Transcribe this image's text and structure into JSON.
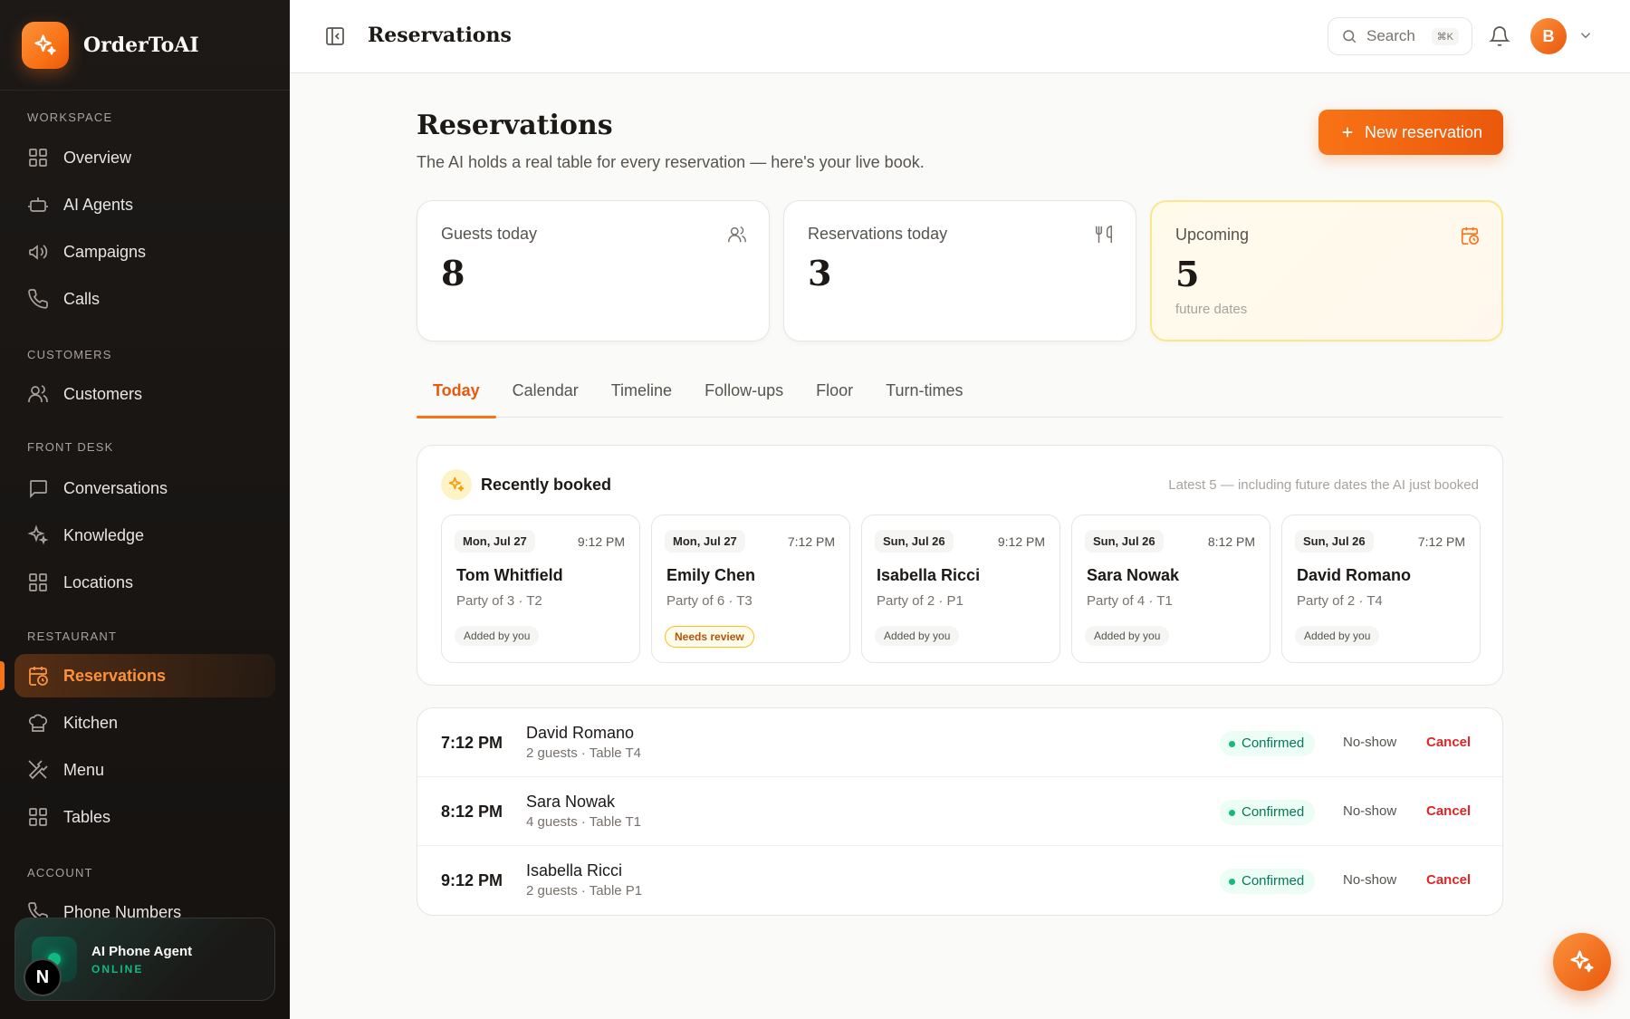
{
  "brand": {
    "name": "OrderToAI",
    "icon": "sparkle-icon",
    "accent": "#f97316"
  },
  "sidebar": {
    "sections": [
      {
        "label": "WORKSPACE",
        "items": [
          {
            "label": "Overview",
            "icon": "grid-icon"
          },
          {
            "label": "AI Agents",
            "icon": "robot-icon"
          },
          {
            "label": "Campaigns",
            "icon": "megaphone-icon"
          },
          {
            "label": "Calls",
            "icon": "phone-icon"
          }
        ]
      },
      {
        "label": "CUSTOMERS",
        "items": [
          {
            "label": "Customers",
            "icon": "users-icon"
          }
        ]
      },
      {
        "label": "FRONT DESK",
        "items": [
          {
            "label": "Conversations",
            "icon": "chat-icon"
          },
          {
            "label": "Knowledge",
            "icon": "sparkle-icon"
          },
          {
            "label": "Locations",
            "icon": "grid-icon"
          }
        ]
      },
      {
        "label": "RESTAURANT",
        "items": [
          {
            "label": "Reservations",
            "icon": "calendar-clock-icon",
            "active": true
          },
          {
            "label": "Kitchen",
            "icon": "chef-hat-icon"
          },
          {
            "label": "Menu",
            "icon": "utensils-crossed-icon"
          },
          {
            "label": "Tables",
            "icon": "grid-icon"
          }
        ]
      },
      {
        "label": "ACCOUNT",
        "items": [
          {
            "label": "Phone Numbers",
            "icon": "phone-icon"
          }
        ]
      }
    ],
    "agent": {
      "title": "AI Phone Agent",
      "status": "ONLINE",
      "status_color": "#10b981"
    },
    "n_badge": "N"
  },
  "topbar": {
    "title": "Reservations",
    "search_placeholder": "Search",
    "search_shortcut": "⌘K",
    "avatar_initial": "B"
  },
  "page": {
    "title": "Reservations",
    "subtitle": "The AI holds a real table for every reservation — here's your live book.",
    "new_button": "New reservation"
  },
  "stats": [
    {
      "label": "Guests today",
      "value": "8",
      "icon": "users-icon"
    },
    {
      "label": "Reservations today",
      "value": "3",
      "icon": "utensils-icon"
    },
    {
      "label": "Upcoming",
      "value": "5",
      "note": "future dates",
      "icon": "calendar-clock-icon"
    }
  ],
  "tabs": [
    "Today",
    "Calendar",
    "Timeline",
    "Follow-ups",
    "Floor",
    "Turn-times"
  ],
  "active_tab": "Today",
  "recent": {
    "title": "Recently booked",
    "note": "Latest 5 — including future dates the AI just booked",
    "cards": [
      {
        "date": "Mon, Jul 27",
        "time": "9:12 PM",
        "name": "Tom Whitfield",
        "party": "Party of 3 · T2",
        "tag": "Added by you",
        "review": false
      },
      {
        "date": "Mon, Jul 27",
        "time": "7:12 PM",
        "name": "Emily Chen",
        "party": "Party of 6 · T3",
        "tag": "Needs review",
        "review": true
      },
      {
        "date": "Sun, Jul 26",
        "time": "9:12 PM",
        "name": "Isabella Ricci",
        "party": "Party of 2 · P1",
        "tag": "Added by you",
        "review": false
      },
      {
        "date": "Sun, Jul 26",
        "time": "8:12 PM",
        "name": "Sara Nowak",
        "party": "Party of 4 · T1",
        "tag": "Added by you",
        "review": false
      },
      {
        "date": "Sun, Jul 26",
        "time": "7:12 PM",
        "name": "David Romano",
        "party": "Party of 2 · T4",
        "tag": "Added by you",
        "review": false
      }
    ]
  },
  "reservations": [
    {
      "time": "7:12 PM",
      "name": "David Romano",
      "meta": "2 guests · Table T4",
      "status": "Confirmed",
      "noshow": "No-show",
      "cancel": "Cancel"
    },
    {
      "time": "8:12 PM",
      "name": "Sara Nowak",
      "meta": "4 guests · Table T1",
      "status": "Confirmed",
      "noshow": "No-show",
      "cancel": "Cancel"
    },
    {
      "time": "9:12 PM",
      "name": "Isabella Ricci",
      "meta": "2 guests · Table P1",
      "status": "Confirmed",
      "noshow": "No-show",
      "cancel": "Cancel"
    }
  ]
}
